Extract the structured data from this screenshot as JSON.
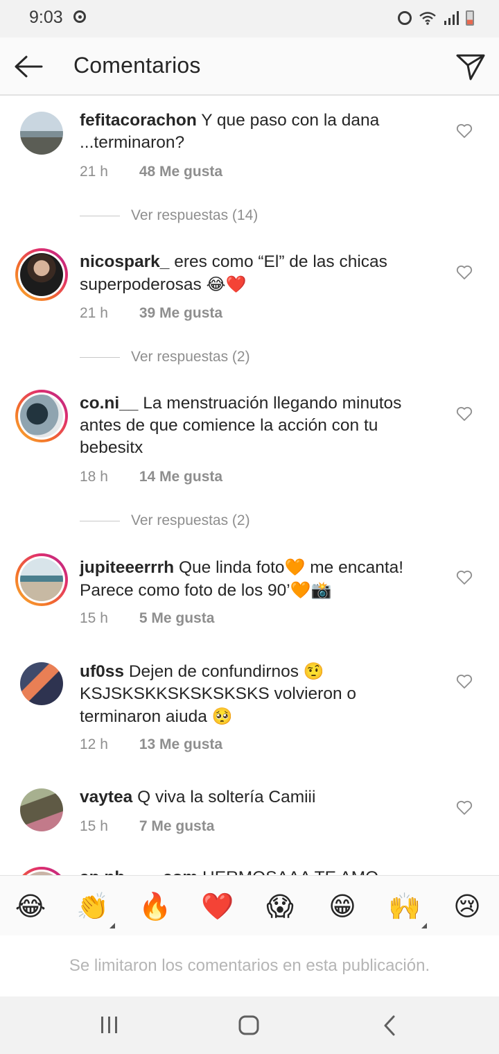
{
  "status_bar": {
    "time": "9:03"
  },
  "header": {
    "title": "Comentarios"
  },
  "comments": [
    {
      "username": "fefitacorachon",
      "text": "Y que paso con la dana ...terminaron?",
      "time": "21 h",
      "likes": "48 Me gusta",
      "replies": "Ver respuestas (14)",
      "story_ring": false
    },
    {
      "username": "nicospark_",
      "text": "eres como “El” de las chicas superpoderosas",
      "emoji": "😂❤️",
      "time": "21 h",
      "likes": "39 Me gusta",
      "replies": "Ver respuestas (2)",
      "story_ring": true
    },
    {
      "username": "co.ni__",
      "text": "La menstruación llegando minutos antes de que comience la acción con tu bebesitx",
      "time": "18 h",
      "likes": "14 Me gusta",
      "replies": "Ver respuestas (2)",
      "story_ring": true
    },
    {
      "username": "jupiteeerrrh",
      "text_a": "Que linda foto",
      "emoji_a": "🧡",
      "text_b": " me encanta! Parece como foto de los 90’",
      "emoji_b": "🧡📸",
      "time": "15 h",
      "likes": "5 Me gusta",
      "story_ring": true
    },
    {
      "username": "uf0ss",
      "text_a": "Dejen de confundirnos",
      "emoji_a": "🤨",
      "text_b": " KSJSKSKKSKSKSKSKS volvieron o terminaron aiuda",
      "emoji_b": "🥺",
      "time": "12 h",
      "likes": "13 Me gusta",
      "story_ring": false
    },
    {
      "username": "vaytea",
      "text": "Q viva la soltería Camiii",
      "time": "15 h",
      "likes": "7 Me gusta",
      "story_ring": false
    },
    {
      "username": "an.ph____com",
      "text": "HERMOSAAA TE AMO",
      "story_ring": true
    }
  ],
  "quick_emojis": [
    "😂",
    "👏",
    "🔥",
    "❤️",
    "😱",
    "😁",
    "🙌",
    "😢"
  ],
  "limit_notice": "Se limitaron los comentarios en esta publicación.",
  "colors": {
    "text_primary": "#262626",
    "text_secondary": "#8e8e8e",
    "story_ring": "#e1306c"
  },
  "icons": {
    "back": "arrow-left-icon",
    "share": "paper-plane-icon",
    "like": "heart-outline-icon"
  }
}
